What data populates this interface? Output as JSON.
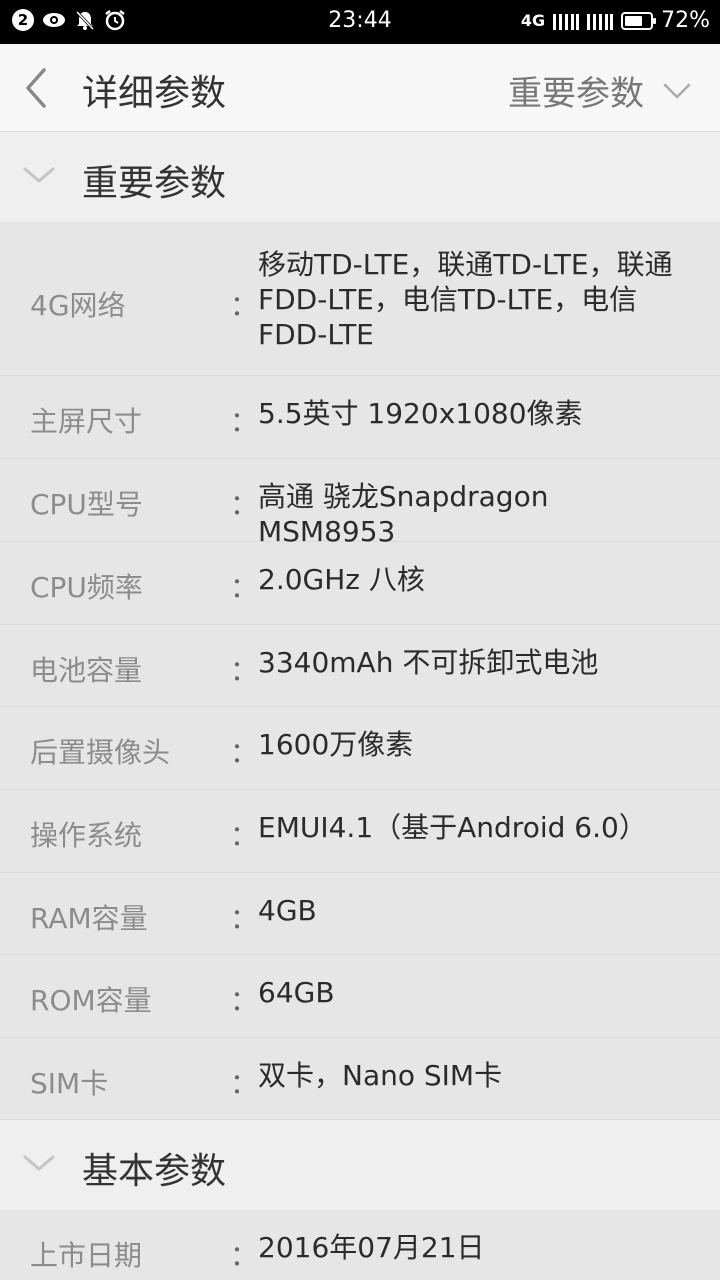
{
  "status_bar": {
    "notification_count": "2",
    "time": "23:44",
    "network": "4G",
    "battery": "72%",
    "battery_level": 0.72,
    "left_icons": [
      "notification-count-icon",
      "eye-icon",
      "bell-mute-icon",
      "alarm-icon"
    ],
    "right_icons": [
      "signal-icon",
      "signal-icon",
      "battery-icon"
    ]
  },
  "toolbar": {
    "title": "详细参数",
    "dropdown_label": "重要参数",
    "back_icon": "back-arrow-icon",
    "dropdown_icon": "chevron-down-icon"
  },
  "sections": [
    {
      "title": "重要参数",
      "rows": [
        {
          "label": "4G网络",
          "value": "移动TD-LTE，联通TD-LTE，联通FDD-LTE，电信TD-LTE，电信FDD-LTE"
        },
        {
          "label": "主屏尺寸",
          "value": "5.5英寸 1920x1080像素"
        },
        {
          "label": "CPU型号",
          "value": "高通 骁龙Snapdragon MSM8953"
        },
        {
          "label": "CPU频率",
          "value": "2.0GHz 八核"
        },
        {
          "label": "电池容量",
          "value": "3340mAh 不可拆卸式电池"
        },
        {
          "label": "后置摄像头",
          "value": "1600万像素"
        },
        {
          "label": "操作系统",
          "value": "EMUI4.1（基于Android 6.0）"
        },
        {
          "label": "RAM容量",
          "value": "4GB"
        },
        {
          "label": "ROM容量",
          "value": "64GB"
        },
        {
          "label": "SIM卡",
          "value": "双卡，Nano SIM卡"
        }
      ]
    },
    {
      "title": "基本参数",
      "rows": [
        {
          "label": "上市日期",
          "value": "2016年07月21日"
        }
      ]
    }
  ],
  "separator": "："
}
